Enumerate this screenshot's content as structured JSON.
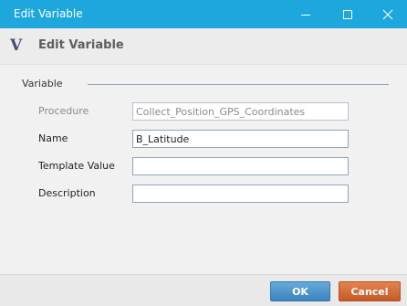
{
  "window": {
    "title": "Edit Variable",
    "controls": {
      "minimize": "minimize",
      "maximize": "maximize",
      "close": "close"
    }
  },
  "header": {
    "logo": "V",
    "title": "Edit Variable"
  },
  "form": {
    "group_label": "Variable",
    "fields": [
      {
        "label": "Procedure",
        "value": "Collect_Position_GPS_Coordinates",
        "disabled": true
      },
      {
        "label": "Name",
        "value": "B_Latitude",
        "disabled": false
      },
      {
        "label": "Template Value",
        "value": "",
        "disabled": false
      },
      {
        "label": "Description",
        "value": "",
        "disabled": false
      }
    ]
  },
  "buttons": {
    "ok": "OK",
    "cancel": "Cancel"
  },
  "colors": {
    "titlebar": "#1ea7dd",
    "ok_button": "#4a93cc",
    "cancel_button": "#d06b36"
  },
  "icons": [
    "minimize-icon",
    "maximize-icon",
    "close-icon",
    "logo-v-icon"
  ]
}
